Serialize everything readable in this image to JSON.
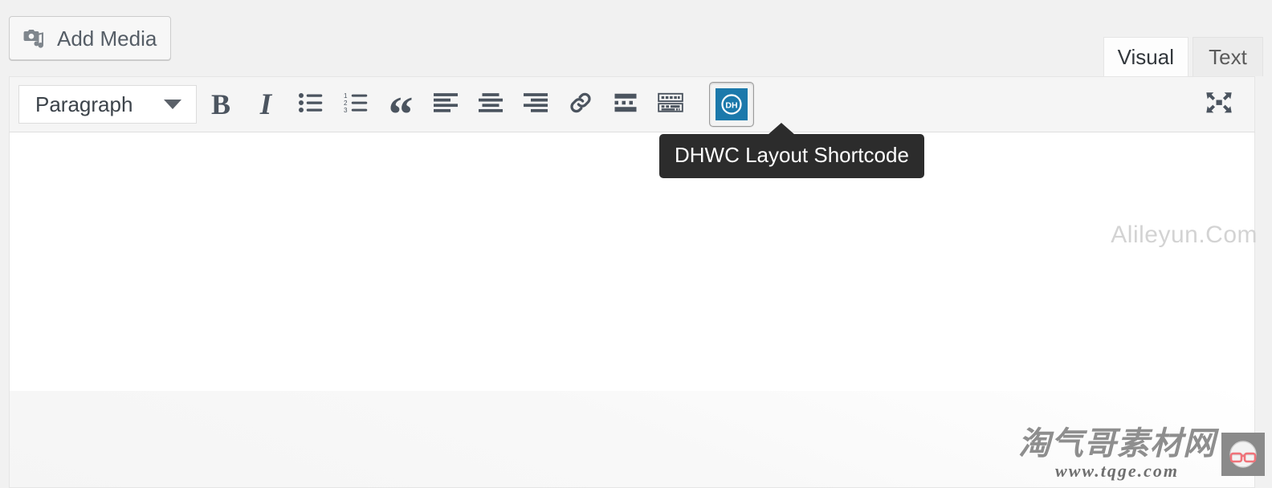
{
  "editor": {
    "add_media": {
      "label": "Add Media",
      "icon": "media-camera-music-icon"
    },
    "tabs": [
      {
        "label": "Visual",
        "active": true
      },
      {
        "label": "Text",
        "active": false
      }
    ],
    "toolbar": {
      "format_select": {
        "value": "Paragraph",
        "caret_icon": "chevron-down-icon"
      },
      "buttons": [
        {
          "name": "bold",
          "glyph": "B",
          "title": "Bold"
        },
        {
          "name": "italic",
          "glyph": "I",
          "title": "Italic"
        },
        {
          "name": "bulleted-list",
          "glyph": "",
          "title": "Bulleted list"
        },
        {
          "name": "numbered-list",
          "glyph": "",
          "title": "Numbered list"
        },
        {
          "name": "blockquote",
          "glyph": "“",
          "title": "Blockquote"
        },
        {
          "name": "align-left",
          "glyph": "",
          "title": "Align left"
        },
        {
          "name": "align-center",
          "glyph": "",
          "title": "Align center"
        },
        {
          "name": "align-right",
          "glyph": "",
          "title": "Align right"
        },
        {
          "name": "insert-link",
          "glyph": "",
          "title": "Insert/edit link"
        },
        {
          "name": "read-more",
          "glyph": "",
          "title": "Insert Read More tag"
        },
        {
          "name": "toolbar-toggle",
          "glyph": "",
          "title": "Toolbar Toggle"
        }
      ],
      "dhwc_button": {
        "name": "dhwc-layout-shortcode",
        "icon_text": "DH",
        "pressed": true,
        "accent_color": "#1b79ab"
      },
      "fullscreen_button": {
        "name": "distraction-free-writing",
        "title": "Distraction-free writing mode"
      }
    },
    "tooltip": {
      "text": "DHWC Layout Shortcode",
      "background": "#2c2c2c",
      "color": "#ffffff"
    },
    "content": {
      "body_text": ""
    }
  },
  "watermarks": {
    "top_right": {
      "text": "Alileyun.Com",
      "color": "#d3d3d3"
    },
    "bottom_right": {
      "chinese": "淘气哥素材网",
      "url": "www.tqge.com",
      "logo": "glasses-face-logo",
      "logo_color": "#f0737a"
    }
  }
}
